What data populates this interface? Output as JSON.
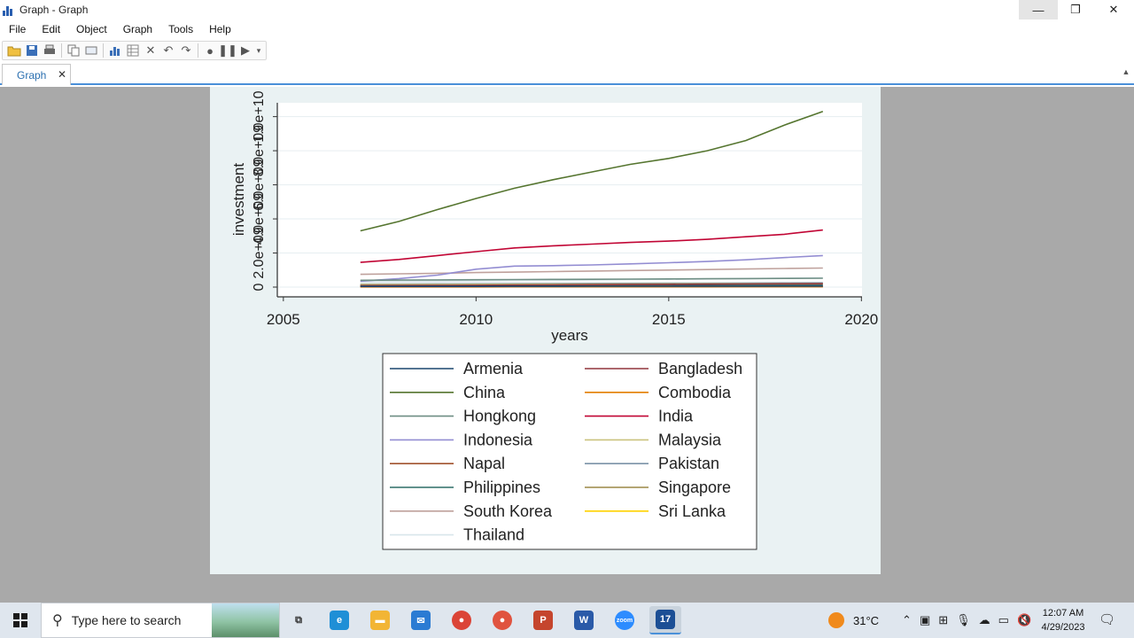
{
  "window": {
    "title": "Graph - Graph",
    "min_glyph": "—",
    "max_glyph": "❐",
    "close_glyph": "✕"
  },
  "menu": [
    "File",
    "Edit",
    "Object",
    "Graph",
    "Tools",
    "Help"
  ],
  "toolbar_icons": [
    "open-icon",
    "save-icon",
    "print-icon",
    "copy-icon",
    "rename-icon",
    "graph-editor-icon",
    "data-browser-icon",
    "clear-icon",
    "undo-icon",
    "redo-icon",
    "record-icon",
    "pause-icon",
    "play-icon",
    "dropdown-icon"
  ],
  "tab": {
    "label": "Graph",
    "close": "✕"
  },
  "chart_data": {
    "type": "line",
    "xlabel": "years",
    "ylabel": "investment",
    "xlim": [
      2005,
      2020
    ],
    "x_ticks": [
      2005,
      2010,
      2015,
      2020
    ],
    "ylim": [
      0,
      10500000000
    ],
    "y_ticks": [
      0,
      2000000000,
      4000000000,
      6000000000,
      8000000000,
      10000000000
    ],
    "y_tick_labels": [
      "0",
      "2.0e+09",
      "4.0e+09",
      "6.0e+09",
      "8.0e+09",
      "1.0e+10"
    ],
    "y_ticklabel_overlap_render": "02.0e407e607e+08.0e+08e+08",
    "legend_position": "bottom",
    "grid": true,
    "x": [
      2007,
      2008,
      2009,
      2010,
      2011,
      2012,
      2013,
      2014,
      2015,
      2016,
      2017,
      2018,
      2019
    ],
    "series": [
      {
        "name": "Armenia",
        "color": "#1a476f",
        "values": [
          40000000,
          40000000,
          42000000,
          44000000,
          46000000,
          48000000,
          50000000,
          52000000,
          54000000,
          56000000,
          58000000,
          60000000,
          62000000
        ]
      },
      {
        "name": "Bangladesh",
        "color": "#90353b",
        "values": [
          90000000,
          95000000,
          100000000,
          110000000,
          120000000,
          130000000,
          140000000,
          150000000,
          160000000,
          170000000,
          180000000,
          190000000,
          200000000
        ]
      },
      {
        "name": "China",
        "color": "#55752f",
        "values": [
          3300000000,
          3850000000,
          4550000000,
          5200000000,
          5800000000,
          6300000000,
          6750000000,
          7200000000,
          7550000000,
          8000000000,
          8600000000,
          9500000000,
          10300000000
        ]
      },
      {
        "name": "Combodia",
        "color": "#e37e00",
        "values": [
          20000000,
          21000000,
          22000000,
          23000000,
          24000000,
          25000000,
          26000000,
          27000000,
          28000000,
          29000000,
          30000000,
          31000000,
          32000000
        ]
      },
      {
        "name": "Hongkong",
        "color": "#6e8e84",
        "values": [
          400000000,
          410000000,
          420000000,
          430000000,
          440000000,
          450000000,
          460000000,
          470000000,
          480000000,
          490000000,
          500000000,
          510000000,
          520000000
        ]
      },
      {
        "name": "India",
        "color": "#c10534",
        "values": [
          1450000000,
          1620000000,
          1850000000,
          2080000000,
          2300000000,
          2420000000,
          2520000000,
          2620000000,
          2700000000,
          2800000000,
          2950000000,
          3100000000,
          3350000000
        ]
      },
      {
        "name": "Indonesia",
        "color": "#938dd2",
        "values": [
          350000000,
          500000000,
          700000000,
          1050000000,
          1230000000,
          1260000000,
          1300000000,
          1360000000,
          1430000000,
          1500000000,
          1600000000,
          1730000000,
          1850000000
        ]
      },
      {
        "name": "Malaysia",
        "color": "#cac27e",
        "values": [
          150000000,
          155000000,
          160000000,
          165000000,
          170000000,
          175000000,
          180000000,
          185000000,
          190000000,
          195000000,
          200000000,
          205000000,
          210000000
        ]
      },
      {
        "name": "Napal",
        "color": "#a0522d",
        "values": [
          10000000,
          10000000,
          11000000,
          12000000,
          13000000,
          14000000,
          15000000,
          16000000,
          17000000,
          18000000,
          19000000,
          20000000,
          21000000
        ]
      },
      {
        "name": "Pakistan",
        "color": "#7b92a8",
        "values": [
          170000000,
          180000000,
          190000000,
          200000000,
          210000000,
          215000000,
          220000000,
          225000000,
          230000000,
          235000000,
          240000000,
          245000000,
          250000000
        ]
      },
      {
        "name": "Philippines",
        "color": "#2d6d66",
        "values": [
          100000000,
          105000000,
          110000000,
          115000000,
          120000000,
          125000000,
          130000000,
          135000000,
          140000000,
          145000000,
          150000000,
          155000000,
          160000000
        ]
      },
      {
        "name": "Singapore",
        "color": "#9c8847",
        "values": [
          60000000,
          62000000,
          64000000,
          66000000,
          68000000,
          70000000,
          72000000,
          74000000,
          76000000,
          78000000,
          80000000,
          82000000,
          84000000
        ]
      },
      {
        "name": "South Korea",
        "color": "#bfa19c",
        "values": [
          750000000,
          780000000,
          810000000,
          850000000,
          880000000,
          910000000,
          940000000,
          970000000,
          1000000000,
          1030000000,
          1060000000,
          1090000000,
          1120000000
        ]
      },
      {
        "name": "Sri Lanka",
        "color": "#ffd200",
        "values": [
          30000000,
          31000000,
          32000000,
          33000000,
          34000000,
          35000000,
          36000000,
          37000000,
          38000000,
          39000000,
          40000000,
          41000000,
          42000000
        ]
      },
      {
        "name": "Thailand",
        "color": "#d9e6eb",
        "values": [
          300000000,
          320000000,
          340000000,
          360000000,
          380000000,
          400000000,
          420000000,
          440000000,
          460000000,
          480000000,
          500000000,
          520000000,
          540000000
        ]
      }
    ]
  },
  "taskbar": {
    "search_placeholder": "Type here to search",
    "apps": [
      {
        "name": "task-view-icon",
        "glyph": "⧉",
        "color": "#333333"
      },
      {
        "name": "edge-icon",
        "glyph": "e",
        "color": "#1f8fd6"
      },
      {
        "name": "file-explorer-icon",
        "glyph": "▬",
        "color": "#f2b535"
      },
      {
        "name": "mail-icon",
        "glyph": "✉",
        "color": "#2b7bd3"
      },
      {
        "name": "chrome-icon",
        "glyph": "●",
        "color": "#db4437"
      },
      {
        "name": "chrome-profile-icon",
        "glyph": "●",
        "color": "#e0533f"
      },
      {
        "name": "powerpoint-icon",
        "glyph": "P",
        "color": "#c5452d"
      },
      {
        "name": "word-icon",
        "glyph": "W",
        "color": "#2a5aa8"
      },
      {
        "name": "zoom-icon",
        "glyph": "zoom",
        "color": "#2d8cff"
      },
      {
        "name": "stata-icon",
        "glyph": "17",
        "color": "#1c4f95"
      }
    ],
    "weather": "31°C",
    "time": "12:07 AM",
    "date": "4/29/2023"
  }
}
